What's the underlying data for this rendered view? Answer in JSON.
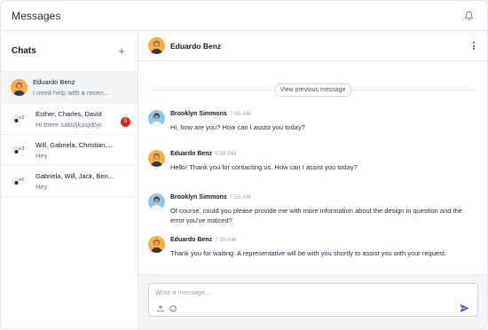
{
  "app": {
    "title": "Messages"
  },
  "sidebar": {
    "heading": "Chats",
    "items": [
      {
        "name": "Eduardo Benz",
        "preview": "I need help with a recen...",
        "active": true,
        "type": "single"
      },
      {
        "name": "Esther, Charles, David",
        "preview": "Hi there sakldjkasjdöjs",
        "extra": "+2",
        "badge": "5",
        "type": "group"
      },
      {
        "name": "Will, Gabriela, Christian,...",
        "preview": "Hey",
        "extra": "+3",
        "type": "group"
      },
      {
        "name": "Gabriela, Will, Jack, Ben...",
        "preview": "Hey",
        "extra": "+6",
        "type": "group"
      }
    ]
  },
  "conversation": {
    "contact_name": "Eduardo Benz",
    "view_previous_label": "View previous message",
    "messages": [
      {
        "author": "Brooklyn Simmons",
        "time": "7:55 AM",
        "text": "Hi, how are you? How can I assist you today?"
      },
      {
        "author": "Eduardo Benz",
        "time": "5:59 PM",
        "text": "Hello! Thank you for contacting us. How can I assist you today?"
      },
      {
        "author": "Brooklyn Simmons",
        "time": "7:55 AM",
        "text": " Of course, could you please provide me with more information about the design in question and the error you've noticed?"
      },
      {
        "author": "Eduardo Benz",
        "time": "7:55 AM",
        "text": "Thank you for waiting. A representative will be with you shortly to assist you with your request."
      }
    ]
  },
  "composer": {
    "placeholder": "Write a message...",
    "value": ""
  },
  "colors": {
    "accent": "#4f46e5",
    "badge": "#dc2626",
    "avatar_orange": "#f4b042",
    "avatar_blue": "#8cc7e8"
  },
  "icons": {
    "bell": "bell-icon",
    "plus": "plus-icon",
    "more": "more-vertical-icon",
    "upload": "upload-icon",
    "emoji": "emoji-icon",
    "send": "send-icon"
  }
}
